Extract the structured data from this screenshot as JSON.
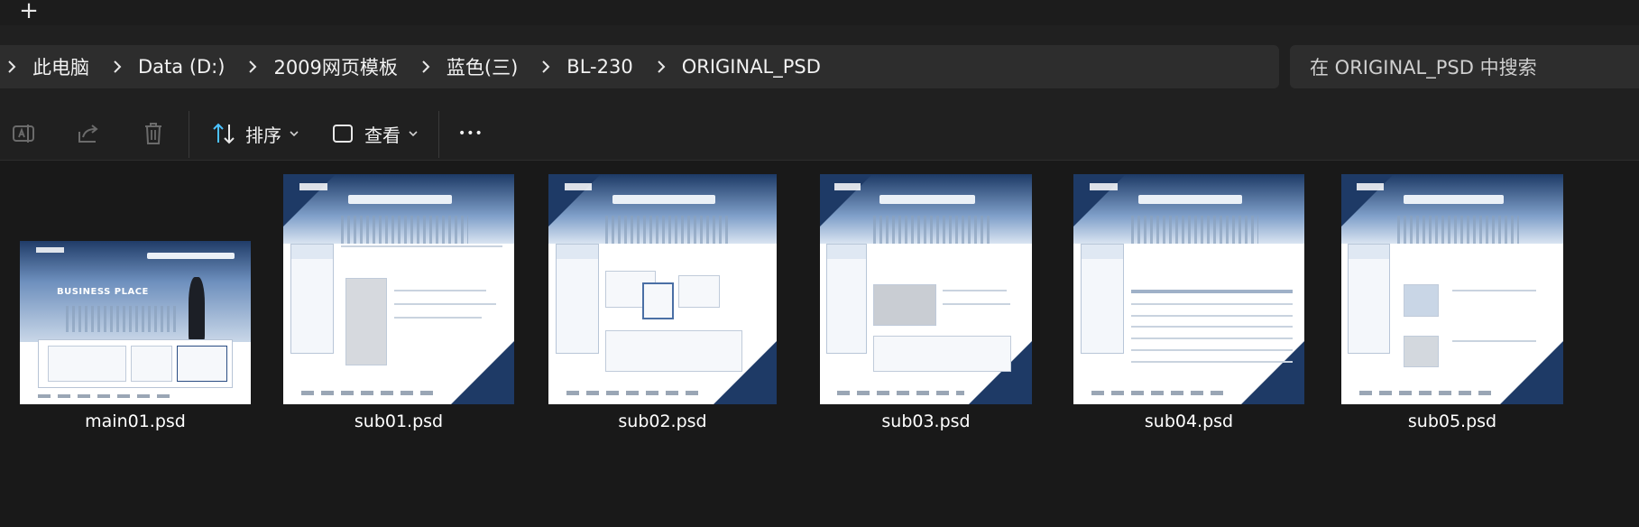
{
  "tabstrip": {
    "new_tab_glyph": "+"
  },
  "breadcrumb": {
    "items": [
      "此电脑",
      "Data (D:)",
      "2009网页模板",
      "蓝色(三)",
      "BL-230",
      "ORIGINAL_PSD"
    ]
  },
  "search": {
    "placeholder": "在 ORIGINAL_PSD 中搜索"
  },
  "toolbar": {
    "icons": [
      "rename-icon",
      "share-icon",
      "delete-icon"
    ],
    "sort_label": "排序",
    "view_label": "查看",
    "more_glyph": "•••"
  },
  "files": [
    {
      "name": "main01.psd",
      "kind": "main"
    },
    {
      "name": "sub01.psd",
      "kind": "sub"
    },
    {
      "name": "sub02.psd",
      "kind": "sub"
    },
    {
      "name": "sub03.psd",
      "kind": "sub"
    },
    {
      "name": "sub04.psd",
      "kind": "sub"
    },
    {
      "name": "sub05.psd",
      "kind": "sub"
    }
  ],
  "thumbnail_text": {
    "main_headline": "BUSINESS PLACE"
  },
  "colors": {
    "background": "#191919",
    "bar": "#202020",
    "field": "#2d2d2d",
    "accent": "#4cc2ff",
    "thumb_navy": "#1e3a66"
  }
}
